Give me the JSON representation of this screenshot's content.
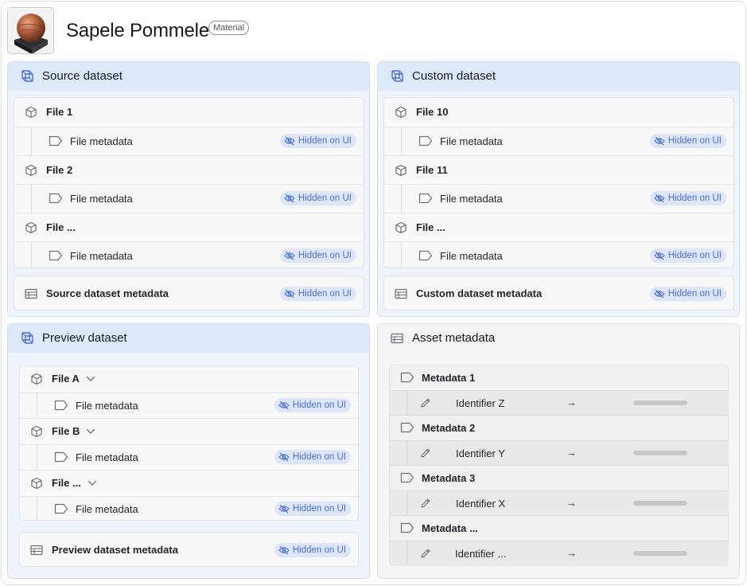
{
  "asset": {
    "title": "Sapele Pommele",
    "type_badge": "Material",
    "thumbnail_icon": "material-sphere-icon"
  },
  "hidden_label": "Hidden on UI",
  "source": {
    "title": "Source dataset",
    "files": [
      {
        "name": "File 1",
        "meta": "File metadata"
      },
      {
        "name": "File 2",
        "meta": "File metadata"
      },
      {
        "name": "File ...",
        "meta": "File metadata"
      }
    ],
    "dataset_meta": "Source dataset metadata"
  },
  "custom": {
    "title": "Custom dataset",
    "files": [
      {
        "name": "File 10",
        "meta": "File metadata"
      },
      {
        "name": "File 11",
        "meta": "File metadata"
      },
      {
        "name": "File ...",
        "meta": "File metadata"
      }
    ],
    "dataset_meta": "Custom dataset metadata"
  },
  "preview": {
    "title": "Preview dataset",
    "files": [
      {
        "name": "File A",
        "meta": "File metadata"
      },
      {
        "name": "File B",
        "meta": "File metadata"
      },
      {
        "name": "File ...",
        "meta": "File metadata"
      }
    ],
    "dataset_meta": "Preview dataset metadata"
  },
  "asset_metadata": {
    "title": "Asset metadata",
    "items": [
      {
        "name": "Metadata 1",
        "identifier": "Identifier Z"
      },
      {
        "name": "Metadata 2",
        "identifier": "Identifier Y"
      },
      {
        "name": "Metadata 3",
        "identifier": "Identifier X"
      },
      {
        "name": "Metadata ...",
        "identifier": "Identifier ..."
      }
    ],
    "arrow": "→"
  },
  "colors": {
    "accent_blue": "#4a6fd6",
    "panel_blue": "#eef3fc",
    "header_blue": "#dde8fb",
    "badge_bg": "#dde6fb"
  }
}
